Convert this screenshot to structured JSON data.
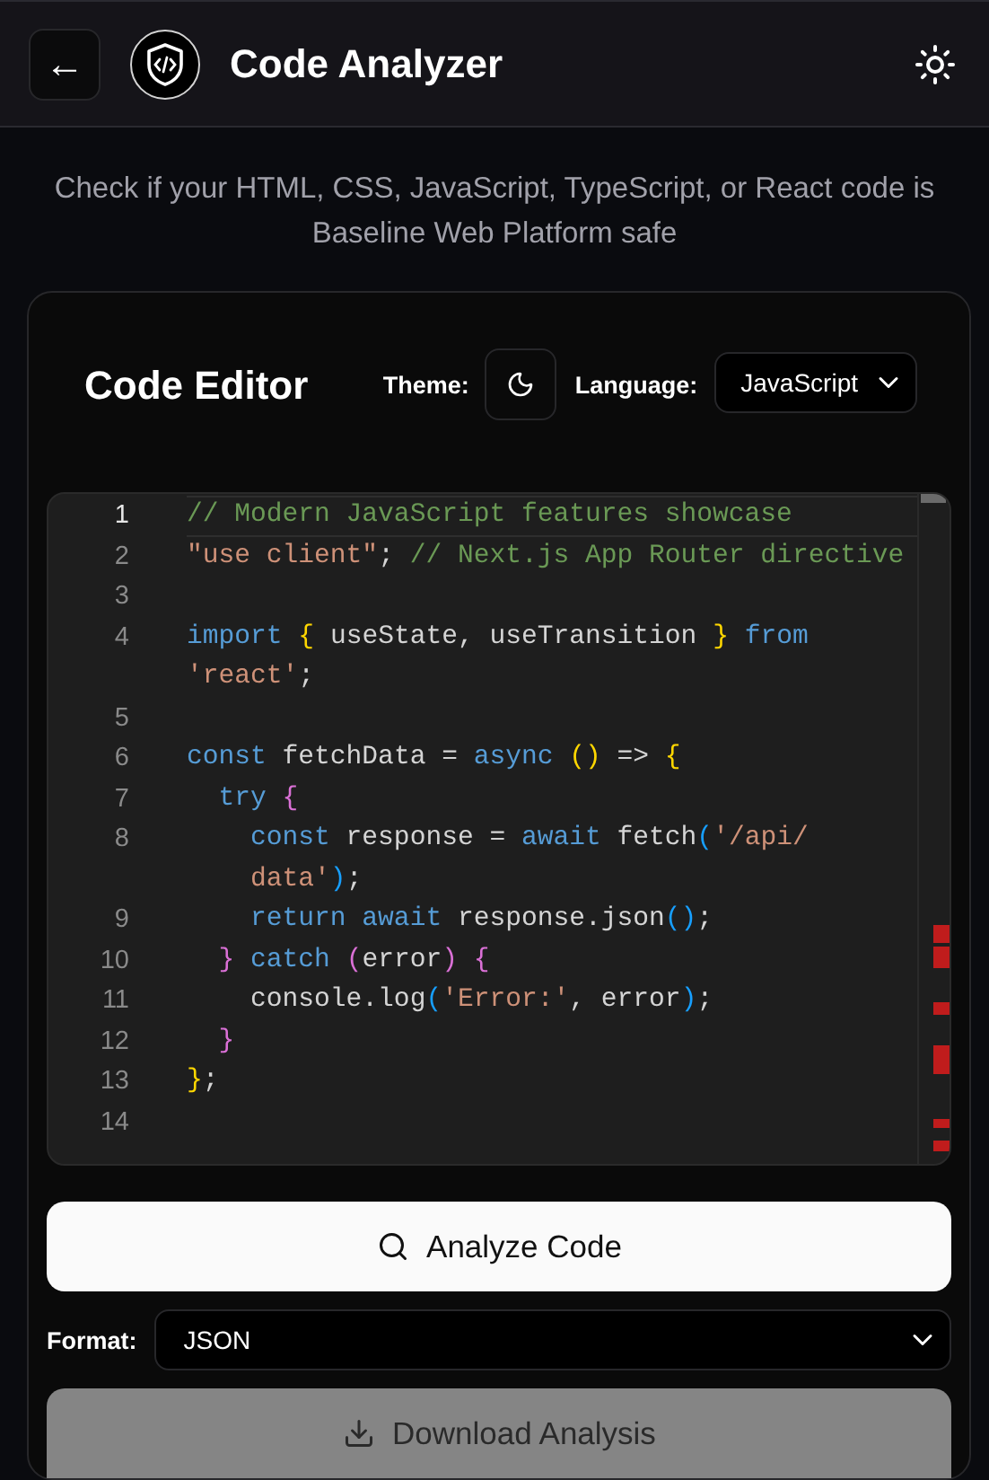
{
  "header": {
    "back_label": "←",
    "title": "Code Analyzer"
  },
  "subtitle": "Check if your HTML, CSS, JavaScript, TypeScript, or React code is Baseline Web Platform safe",
  "editor": {
    "title": "Code Editor",
    "theme_label": "Theme:",
    "language_label": "Language:",
    "language": "JavaScript",
    "lines": [
      {
        "number": "1",
        "selected": true,
        "rows": [
          {
            "tokens": [
              {
                "kind": "cmt",
                "text": "// Modern JavaScript features showcase"
              }
            ]
          }
        ]
      },
      {
        "number": "2",
        "selected": false,
        "rows": [
          {
            "tokens": [
              {
                "kind": "str",
                "text": "\"use client\""
              },
              {
                "kind": "plain",
                "text": "; "
              },
              {
                "kind": "cmt",
                "text": "// Next.js App Router directive"
              }
            ]
          }
        ]
      },
      {
        "number": "3",
        "selected": false,
        "rows": [
          {}
        ]
      },
      {
        "number": "4",
        "selected": false,
        "rows": [
          {
            "tokens": [
              {
                "kind": "kw",
                "text": "import "
              },
              {
                "kind": "b1",
                "text": "{"
              },
              {
                "kind": "plain",
                "text": " useState, useTransition "
              },
              {
                "kind": "b1",
                "text": "}"
              },
              {
                "kind": "kw",
                "text": " from"
              }
            ]
          },
          {
            "tokens": [
              {
                "kind": "str",
                "text": "'react'"
              },
              {
                "kind": "plain",
                "text": ";"
              }
            ]
          }
        ]
      },
      {
        "number": "5",
        "selected": false,
        "rows": [
          {}
        ]
      },
      {
        "number": "6",
        "selected": false,
        "rows": [
          {
            "tokens": [
              {
                "kind": "kw",
                "text": "const "
              },
              {
                "kind": "plain",
                "text": "fetchData = "
              },
              {
                "kind": "kw",
                "text": "async "
              },
              {
                "kind": "b1",
                "text": "()"
              },
              {
                "kind": "plain",
                "text": " => "
              },
              {
                "kind": "b1",
                "text": "{"
              }
            ]
          }
        ]
      },
      {
        "number": "7",
        "selected": false,
        "rows": [
          {
            "tokens": [
              {
                "kind": "kw",
                "text": "  try "
              },
              {
                "kind": "b2",
                "text": "{"
              }
            ]
          }
        ]
      },
      {
        "number": "8",
        "selected": false,
        "rows": [
          {
            "tokens": [
              {
                "kind": "kw",
                "text": "    const "
              },
              {
                "kind": "plain",
                "text": "response = "
              },
              {
                "kind": "kw",
                "text": "await "
              },
              {
                "kind": "plain",
                "text": "fetch"
              },
              {
                "kind": "b3",
                "text": "("
              },
              {
                "kind": "str",
                "text": "'/api/"
              }
            ]
          },
          {
            "tokens": [
              {
                "kind": "str",
                "text": "    data'"
              },
              {
                "kind": "b3",
                "text": ")"
              },
              {
                "kind": "plain",
                "text": ";"
              }
            ]
          }
        ]
      },
      {
        "number": "9",
        "selected": false,
        "rows": [
          {
            "tokens": [
              {
                "kind": "kw",
                "text": "    return await "
              },
              {
                "kind": "plain",
                "text": "response.json"
              },
              {
                "kind": "b3",
                "text": "()"
              },
              {
                "kind": "plain",
                "text": ";"
              }
            ]
          }
        ]
      },
      {
        "number": "10",
        "selected": false,
        "rows": [
          {
            "tokens": [
              {
                "kind": "b2",
                "text": "  }"
              },
              {
                "kind": "kw",
                "text": " catch "
              },
              {
                "kind": "b2",
                "text": "("
              },
              {
                "kind": "plain",
                "text": "error"
              },
              {
                "kind": "b2",
                "text": ") {"
              }
            ]
          }
        ]
      },
      {
        "number": "11",
        "selected": false,
        "rows": [
          {
            "tokens": [
              {
                "kind": "plain",
                "text": "    console.log"
              },
              {
                "kind": "b3",
                "text": "("
              },
              {
                "kind": "str",
                "text": "'Error:'"
              },
              {
                "kind": "plain",
                "text": ", error"
              },
              {
                "kind": "b3",
                "text": ")"
              },
              {
                "kind": "plain",
                "text": ";"
              }
            ]
          }
        ]
      },
      {
        "number": "12",
        "selected": false,
        "rows": [
          {
            "tokens": [
              {
                "kind": "b2",
                "text": "  }"
              }
            ]
          }
        ]
      },
      {
        "number": "13",
        "selected": false,
        "rows": [
          {
            "tokens": [
              {
                "kind": "b1",
                "text": "}"
              },
              {
                "kind": "plain",
                "text": ";"
              }
            ]
          }
        ]
      },
      {
        "number": "14",
        "selected": false,
        "rows": [
          {}
        ]
      }
    ]
  },
  "analyze_button": "Analyze Code",
  "format": {
    "label": "Format:",
    "value": "JSON"
  },
  "download_button": {
    "label": "Download Analysis",
    "disabled": true
  }
}
